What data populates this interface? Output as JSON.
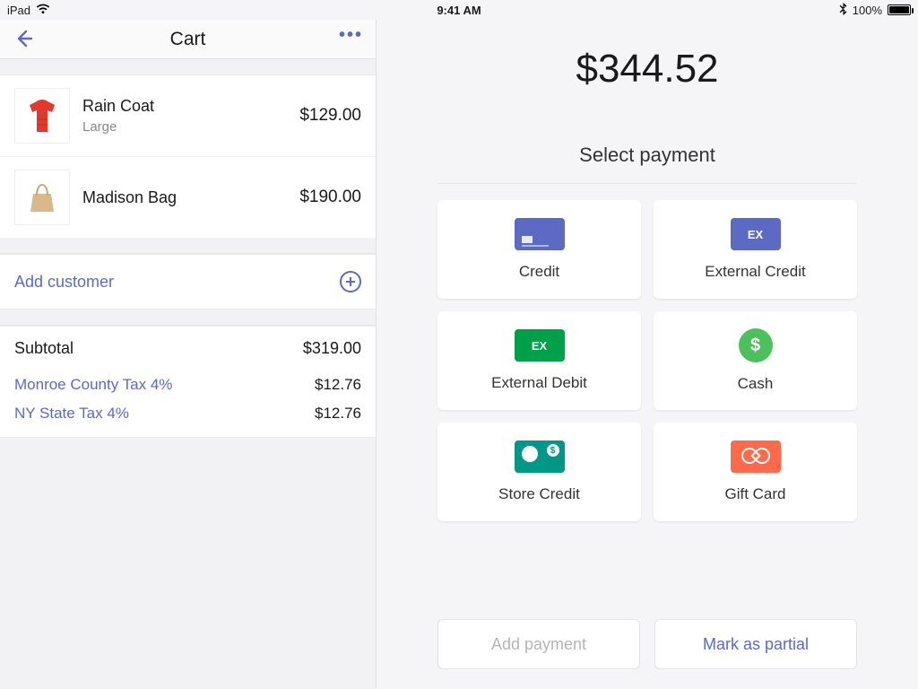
{
  "statusbar": {
    "device": "iPad",
    "time": "9:41 AM",
    "battery_pct": "100%"
  },
  "cart": {
    "title": "Cart",
    "items": [
      {
        "name": "Rain Coat",
        "variant": "Large",
        "price": "$129.00"
      },
      {
        "name": "Madison Bag",
        "variant": "",
        "price": "$190.00"
      }
    ],
    "add_customer": "Add customer",
    "totals": {
      "subtotal_label": "Subtotal",
      "subtotal": "$319.00",
      "taxes": [
        {
          "label": "Monroe County Tax 4%",
          "value": "$12.76"
        },
        {
          "label": "NY State Tax 4%",
          "value": "$12.76"
        }
      ]
    }
  },
  "payment": {
    "grand_total": "$344.52",
    "prompt": "Select payment",
    "methods": [
      {
        "label": "Credit"
      },
      {
        "label": "External Credit"
      },
      {
        "label": "External Debit"
      },
      {
        "label": "Cash"
      },
      {
        "label": "Store Credit"
      },
      {
        "label": "Gift Card"
      }
    ],
    "add_payment": "Add payment",
    "mark_partial": "Mark as partial"
  }
}
